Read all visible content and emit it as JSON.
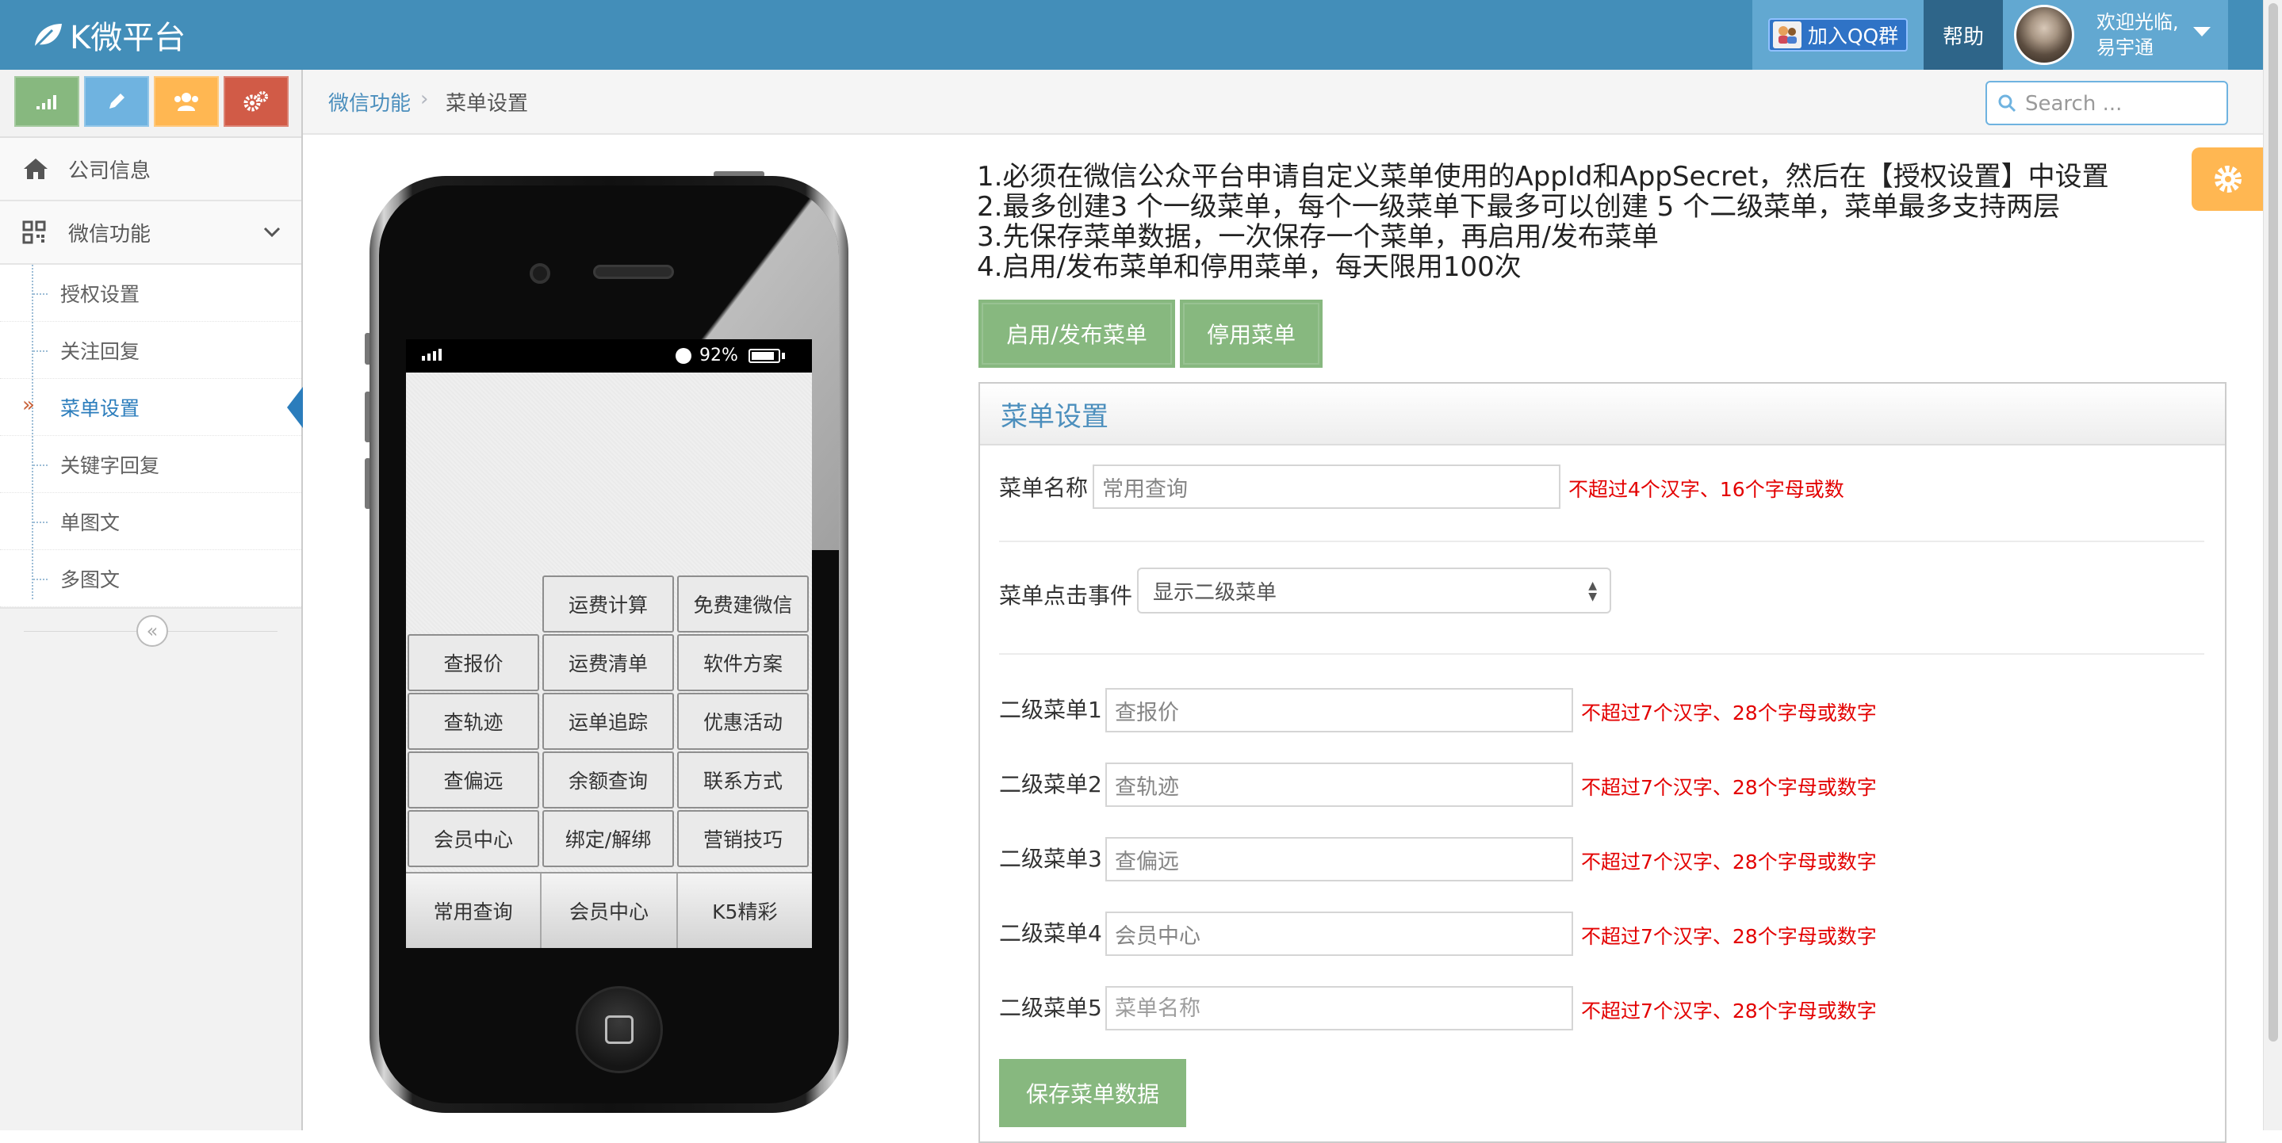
{
  "header": {
    "brand": "K微平台",
    "qq_group_label": "加入QQ群",
    "help_label": "帮助",
    "welcome_line1": "欢迎光临,",
    "welcome_line2": "易宇通"
  },
  "sidebar": {
    "shortcut_colors": [
      "#87b87f",
      "#6fb3e0",
      "#ffb752",
      "#d15b47"
    ],
    "items": [
      {
        "label": "公司信息",
        "icon": "home-icon"
      },
      {
        "label": "微信功能",
        "icon": "qrcode-icon"
      }
    ],
    "sub_items": [
      {
        "label": "授权设置"
      },
      {
        "label": "关注回复"
      },
      {
        "label": "菜单设置",
        "active": true
      },
      {
        "label": "关键字回复"
      },
      {
        "label": "单图文"
      },
      {
        "label": "多图文"
      }
    ]
  },
  "breadcrumb": {
    "parent": "微信功能",
    "current": "菜单设置"
  },
  "search": {
    "placeholder": "Search ..."
  },
  "phone": {
    "battery_text": "92%",
    "submenu_columns": [
      [
        "查报价",
        "查轨迹",
        "查偏远",
        "会员中心"
      ],
      [
        "运费计算",
        "运费清单",
        "运单追踪",
        "余额查询",
        "绑定/解绑"
      ],
      [
        "免费建微信",
        "软件方案",
        "优惠活动",
        "联系方式",
        "营销技巧"
      ]
    ],
    "main_menu": [
      "常用查询",
      "会员中心",
      "K5精彩"
    ]
  },
  "notes": [
    "1.必须在微信公众平台申请自定义菜单使用的AppId和AppSecret，然后在【授权设置】中设置",
    "2.最多创建3 个一级菜单，每个一级菜单下最多可以创建 5 个二级菜单，菜单最多支持两层",
    "3.先保存菜单数据，一次保存一个菜单，再启用/发布菜单",
    "4.启用/发布菜单和停用菜单，每天限用100次"
  ],
  "actions": {
    "publish_label": "启用/发布菜单",
    "disable_label": "停用菜单"
  },
  "panel": {
    "title": "菜单设置",
    "menu_name_label": "菜单名称",
    "menu_name_value": "常用查询",
    "menu_name_hint": "不超过4个汉字、16个字母或数",
    "click_event_label": "菜单点击事件",
    "click_event_value": "显示二级菜单",
    "submenu_fields": [
      {
        "label": "二级菜单1",
        "value": "查报价",
        "placeholder": "",
        "hint": "不超过7个汉字、28个字母或数字"
      },
      {
        "label": "二级菜单2",
        "value": "查轨迹",
        "placeholder": "",
        "hint": "不超过7个汉字、28个字母或数字"
      },
      {
        "label": "二级菜单3",
        "value": "查偏远",
        "placeholder": "",
        "hint": "不超过7个汉字、28个字母或数字"
      },
      {
        "label": "二级菜单4",
        "value": "会员中心",
        "placeholder": "",
        "hint": "不超过7个汉字、28个字母或数字"
      },
      {
        "label": "二级菜单5",
        "value": "",
        "placeholder": "菜单名称",
        "hint": "不超过7个汉字、28个字母或数字"
      }
    ],
    "save_label": "保存菜单数据"
  },
  "colors": {
    "navbar": "#438eb9",
    "accent_green": "#87b87f",
    "link_blue": "#4c8fbd",
    "hint_red": "#e30000"
  }
}
